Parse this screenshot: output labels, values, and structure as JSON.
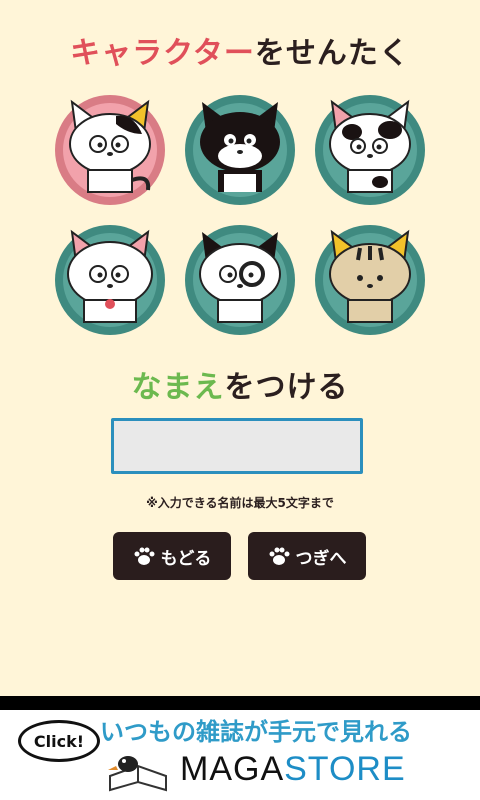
{
  "header": {
    "select_title_part1": "キャラクター",
    "select_title_part2": "をせんたく"
  },
  "name_section": {
    "title_part1": "なまえ",
    "title_part2": "をつける",
    "input_value": "",
    "note": "※入力できる名前は最大5文字まで"
  },
  "buttons": {
    "back_label": "もどる",
    "next_label": "つぎへ"
  },
  "characters": [
    {
      "icon": "calico-cat-icon",
      "ring": "#d97c85",
      "fill": "#f2a2ab"
    },
    {
      "icon": "black-cat-icon",
      "ring": "#3f8a80",
      "fill": "#5aa59a"
    },
    {
      "icon": "spotted-cat-icon",
      "ring": "#3f8a80",
      "fill": "#5aa59a"
    },
    {
      "icon": "fluffy-white-cat-icon",
      "ring": "#3f8a80",
      "fill": "#5aa59a"
    },
    {
      "icon": "monocle-cat-icon",
      "ring": "#3f8a80",
      "fill": "#5aa59a"
    },
    {
      "icon": "tabby-cat-icon",
      "ring": "#3f8a80",
      "fill": "#5aa59a"
    }
  ],
  "ad": {
    "click_label": "Click!",
    "tagline": "いつもの雑誌が手元で見れる",
    "logo_part1": "MAGA",
    "logo_part2": "STORE"
  },
  "colors": {
    "background": "#fff5d8",
    "accent_red": "#e0505a",
    "accent_green": "#6cb94f",
    "button": "#2a1d1d",
    "input_border": "#2b8fbd"
  }
}
